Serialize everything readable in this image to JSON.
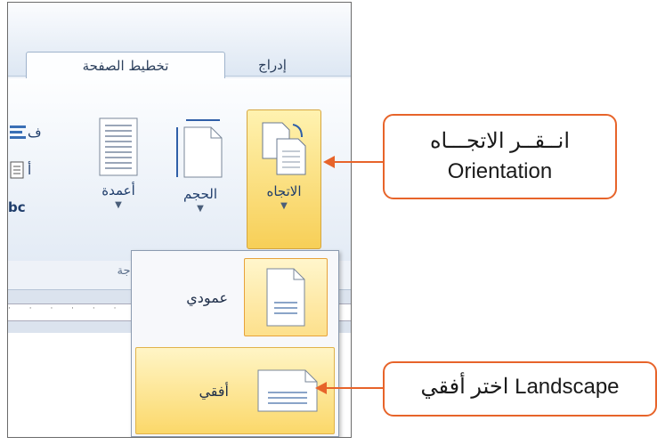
{
  "ribbon": {
    "tabs": [
      {
        "label": "تخطيط الصفحة",
        "active": true
      },
      {
        "label": "إدراج",
        "active": false
      }
    ],
    "buttons": {
      "orientation": {
        "label": "الاتجاه",
        "icon": "orientation-icon"
      },
      "size": {
        "label": "الحجم",
        "icon": "page-size-icon"
      },
      "columns": {
        "label": "أعمدة",
        "icon": "columns-icon"
      }
    },
    "small_tools": [
      "ف",
      "أ",
      "bc"
    ],
    "group_label": "جة"
  },
  "menu": {
    "items": [
      {
        "label": "عمودي",
        "icon": "portrait-page-icon",
        "state": "current"
      },
      {
        "label": "أفقي",
        "icon": "landscape-page-icon",
        "state": "highlighted"
      }
    ]
  },
  "ruler": {
    "marks": "· · · · · · · · · · · · · · · ·"
  },
  "callouts": {
    "orientation_line1": "انــقــر الاتجـــاه",
    "orientation_line2": "Orientation",
    "landscape": "اختر أفقي Landscape"
  },
  "colors": {
    "accent": "#e7642a",
    "highlight": "#fbd86a",
    "ribbon_text": "#1f3d6b"
  }
}
